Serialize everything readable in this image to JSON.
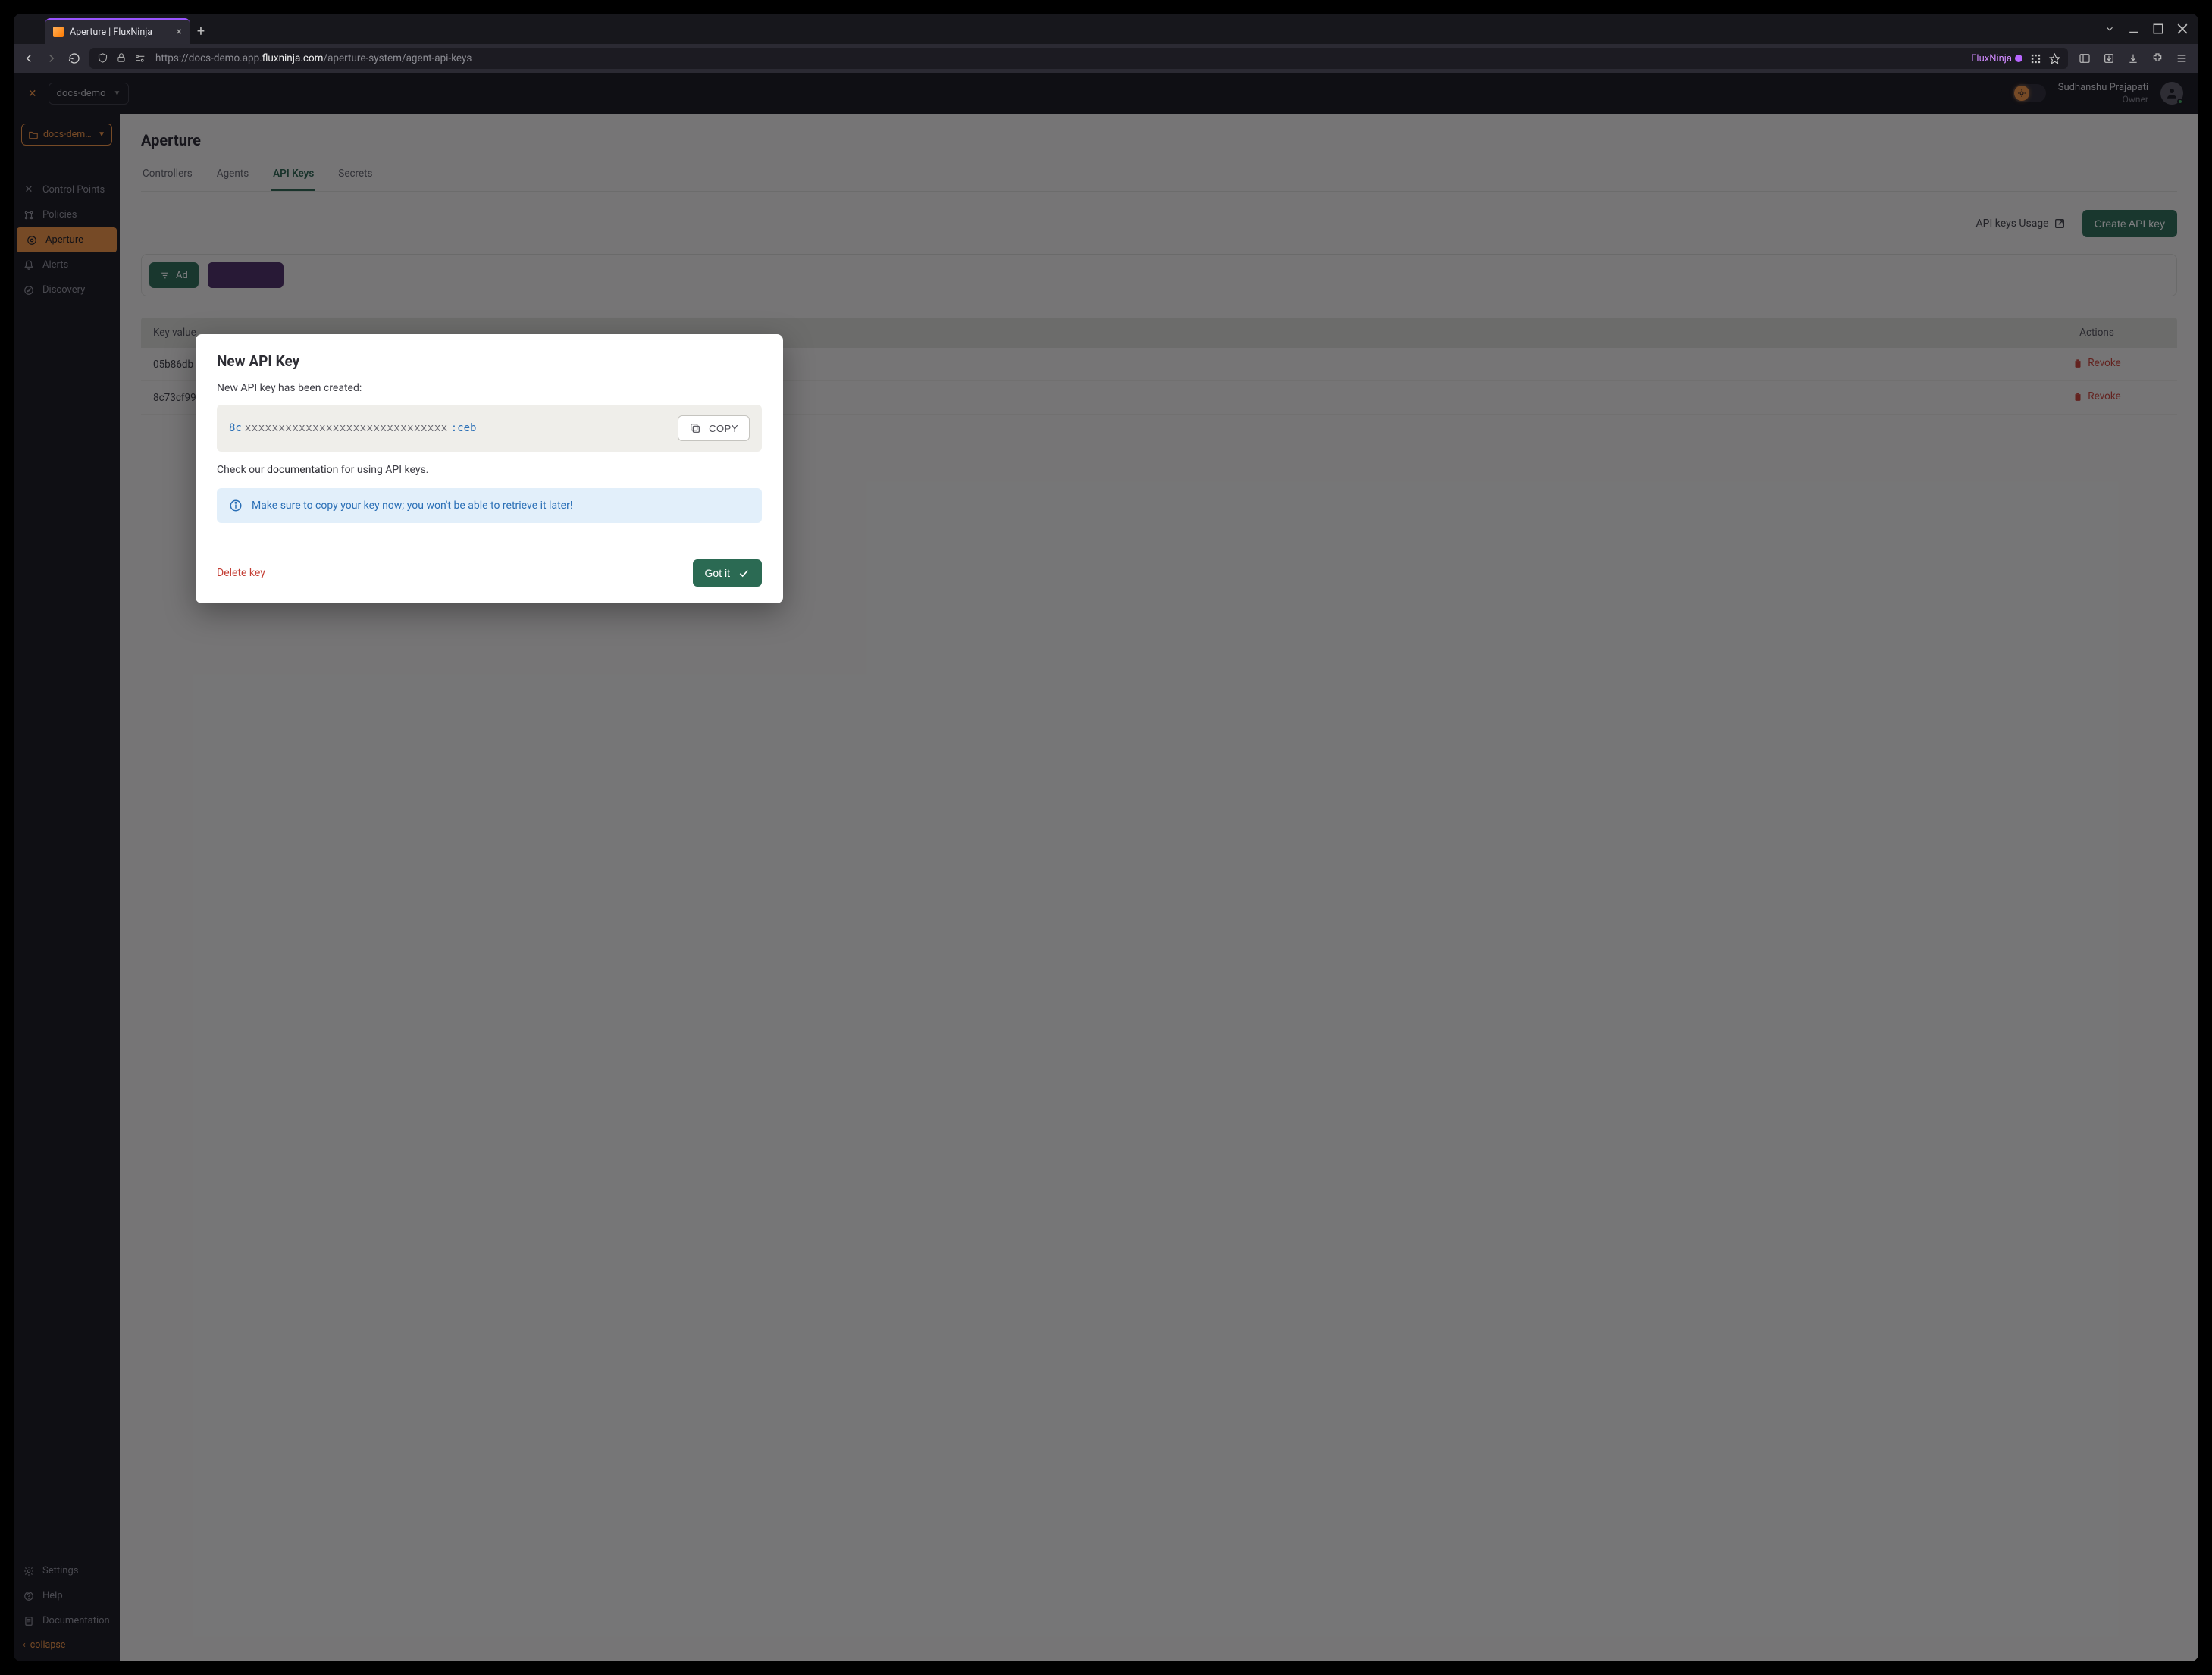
{
  "browser": {
    "tab_title": "Aperture | FluxNinja",
    "url_prefix": "https://docs-demo.app.",
    "url_domain": "fluxninja.com",
    "url_path": "/aperture-system/agent-api-keys",
    "tag": "FluxNinja"
  },
  "topbar": {
    "project": "docs-demo",
    "user_name": "Sudhanshu Prajapati",
    "user_role": "Owner"
  },
  "sidebar": {
    "project": "docs-dem…",
    "items": [
      {
        "label": "Control Points"
      },
      {
        "label": "Policies"
      },
      {
        "label": "Aperture"
      },
      {
        "label": "Alerts"
      },
      {
        "label": "Discovery"
      }
    ],
    "bottom": [
      {
        "label": "Settings"
      },
      {
        "label": "Help"
      },
      {
        "label": "Documentation"
      }
    ],
    "collapse": "collapse"
  },
  "page": {
    "title": "Aperture",
    "tabs": [
      "Controllers",
      "Agents",
      "API Keys",
      "Secrets"
    ],
    "usage_link": "API keys Usage",
    "create_btn": "Create API key",
    "filter_chip": "Ad",
    "table": {
      "col_key": "Key value",
      "col_actions": "Actions",
      "rows": [
        {
          "key": "05b86db",
          "action": "Revoke"
        },
        {
          "key": "8c73cf99",
          "action": "Revoke"
        }
      ]
    }
  },
  "modal": {
    "title": "New API Key",
    "subtitle": "New API key has been created:",
    "key_prefix": "8c",
    "key_mask": "xxxxxxxxxxxxxxxxxxxxxxxxxxxxxx",
    "key_suffix": ":ceb",
    "copy": "COPY",
    "doc_before": "Check our ",
    "doc_link": "documentation",
    "doc_after": " for using API keys.",
    "info": "Make sure to copy your key now; you won't be able to retrieve it later!",
    "delete": "Delete key",
    "gotit": "Got it"
  }
}
